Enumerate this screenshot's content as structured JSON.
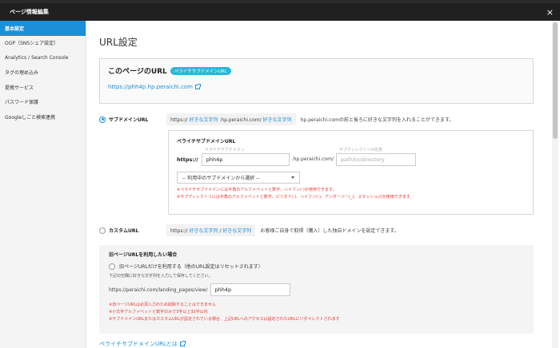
{
  "modal": {
    "title": "ページ情報編集",
    "close_label": "×"
  },
  "sidebar": {
    "items": [
      {
        "label": "基本設定",
        "active": true
      },
      {
        "label": "OGP（SNSシェア設定）",
        "active": false
      },
      {
        "label": "Analytics / Search Console",
        "active": false
      },
      {
        "label": "タグの埋め込み",
        "active": false
      },
      {
        "label": "提携サービス",
        "active": false
      },
      {
        "label": "パスワード保護",
        "active": false
      },
      {
        "label": "Googleしごと検索連携",
        "active": false
      }
    ]
  },
  "main": {
    "title": "URL設定",
    "current_url_box": {
      "title": "このページのURL",
      "badge": "ペライチサブドメインURL",
      "url": "https://phh4p.hp.peraichi.com"
    },
    "subdomain_option": {
      "label": "サブドメインURL",
      "checked": true,
      "pattern_prefix": "https://",
      "pattern_hl1": "好きな文字列",
      "pattern_mid": ".hp.peraichi.com/",
      "pattern_hl2": "好きな文字列",
      "description": "hp.peraichi.comの前と後ろに好きな文字列を入れることができます。",
      "panel": {
        "title": "ペライチサブドメインURL",
        "subdomain_field_label": "ペライチサブドメイン",
        "directory_field_label": "サブディレクトリ※任意",
        "https_label": "https://",
        "subdomain_value": "phh4p",
        "domain_suffix": ".hp.peraichi.com/",
        "directory_placeholder": "path/to/directory",
        "select_value": "-- 利用中のサブドメインから選択 --",
        "note1": "※ペライチサブドメインには半角のアルファベットと数字、ハイフン(-)が使用できます。",
        "note2": "※サブディレクトリには半角のアルファベットと数字、ピリオド(.)、ハイフン(-)、アンダーバー(_)、スラッシュ(/)が使用できます。"
      }
    },
    "custom_option": {
      "label": "カスタムURL",
      "checked": false,
      "pattern_prefix": "https://",
      "pattern_hl1": "好きな文字列",
      "pattern_mid": " / ",
      "pattern_hl2": "好きな文字列",
      "description": "お客様ご自身で取得（購入）した独自ドメインを設定できます。"
    },
    "old_url_box": {
      "title": "旧ページURLを利用したい場合",
      "radio_label": "旧ページURLだけを利用する（他のURL設定はリセットされます）",
      "hint": "下記の空欄に好きな文字列を入力して保存してください。",
      "url_prefix": "https://peraichi.com/landing_pages/view/",
      "url_value": "phh4p",
      "note1": "※旧ページURLは必須入力のため削除することはできません",
      "note2": "※小文字アルファベットと数字のみで3字以上32字以内",
      "note3": "※サブドメインURLまたはカスタムURLが設定されている場合、上記URLへのアクセスは設定されたURLにリダイレクトされます"
    },
    "footer_link": "ペライチサブドメインURLとは"
  },
  "colors": {
    "accent": "#1d8fd8",
    "badge": "#29b6d9",
    "error": "#e53935",
    "header": "#202020"
  }
}
